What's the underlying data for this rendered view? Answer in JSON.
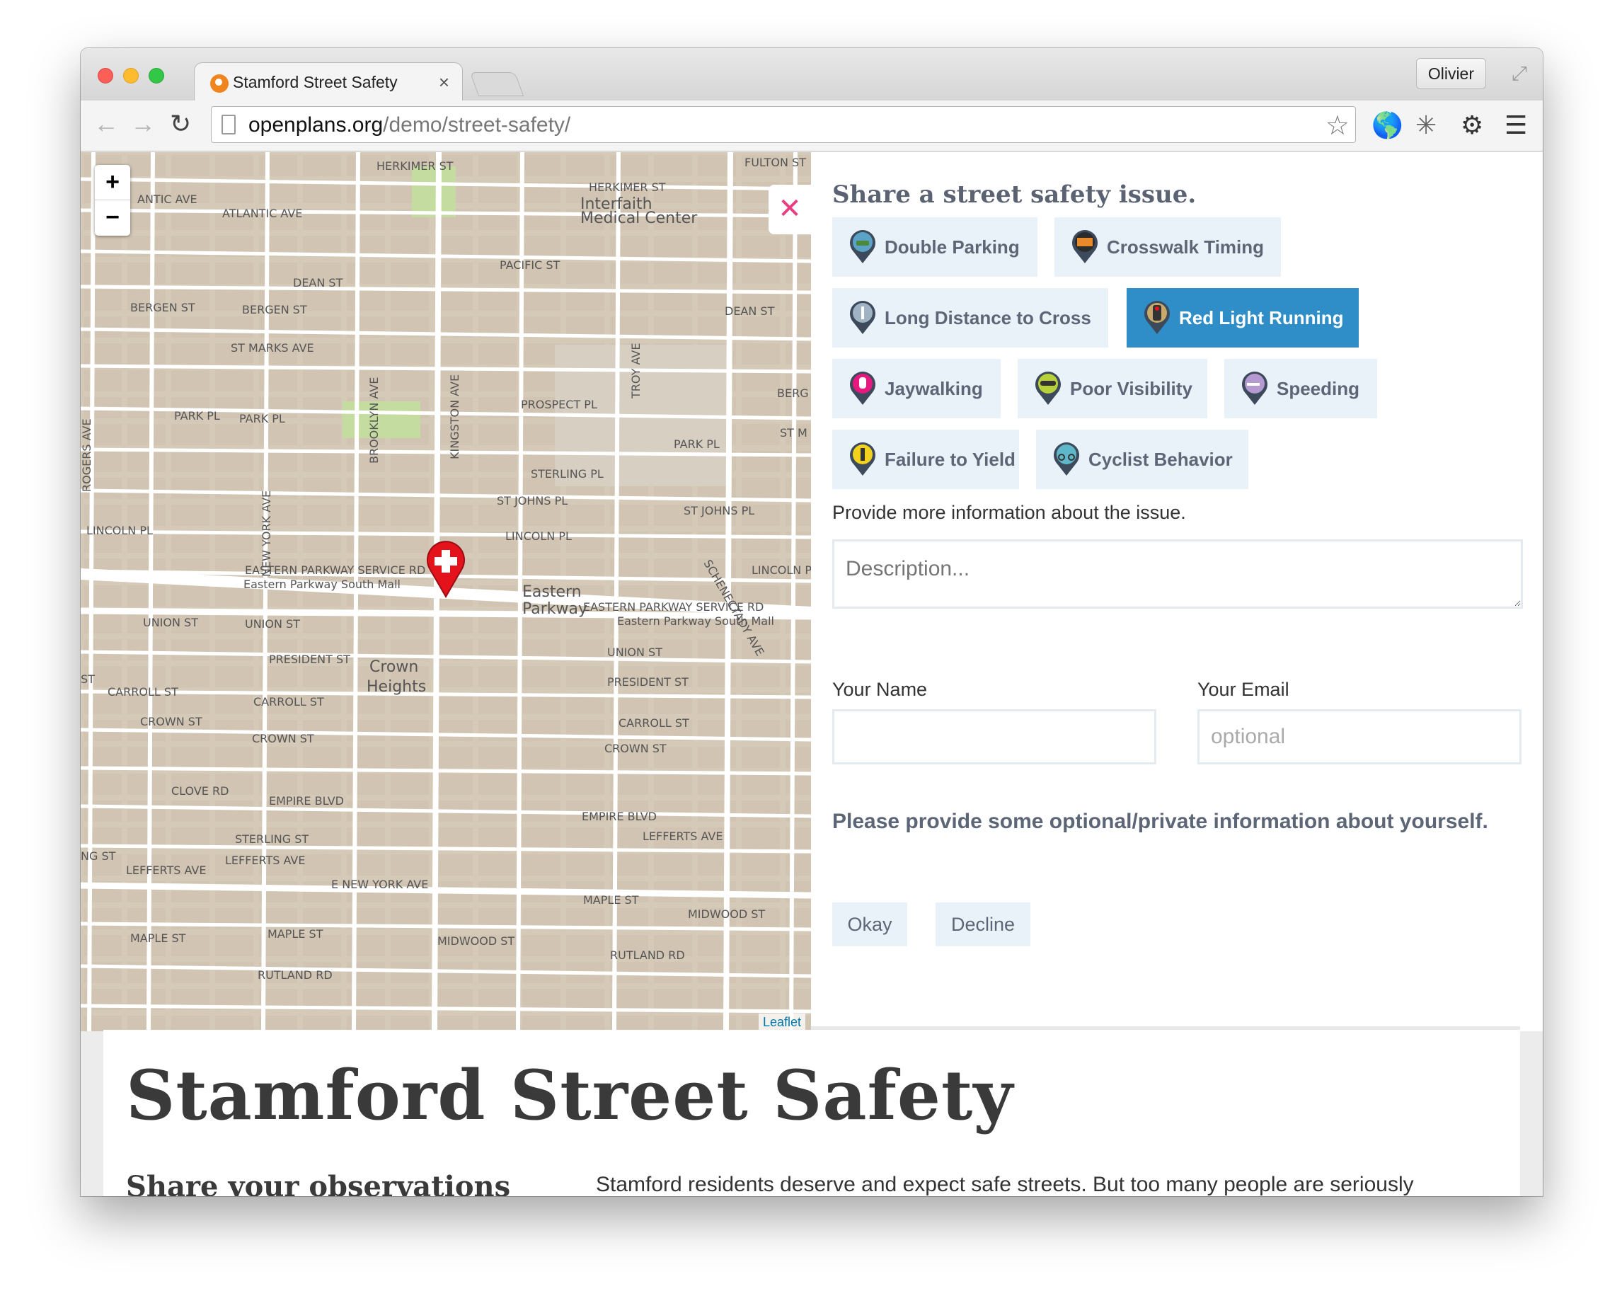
{
  "browser": {
    "tab_title": "Stamford Street Safety",
    "tab_close": "×",
    "profile_name": "Olivier",
    "url_host": "openplans.org",
    "url_path": "/demo/street-safety/",
    "back_icon": "←",
    "forward_icon": "→",
    "reload_icon": "↻",
    "star_icon": "☆",
    "fullscreen_icon": "⤢",
    "extensions": [
      {
        "name": "globe-icon",
        "glyph": "🌎"
      },
      {
        "name": "puzzle-extension-icon",
        "glyph": "✳"
      },
      {
        "name": "gear-icon",
        "glyph": "⚙"
      },
      {
        "name": "menu-icon",
        "glyph": "☰"
      }
    ]
  },
  "map": {
    "zoom_in": "+",
    "zoom_out": "−",
    "attribution": "Leaflet",
    "labels": [
      "HERKIMER ST",
      "FULTON ST",
      "HERKIMER ST",
      "Interfaith",
      "Medical Center",
      "ATLANTIC AVE",
      "ANTIC AVE",
      "PACIFIC ST",
      "DEAN ST",
      "BERGEN ST",
      "BERGEN ST",
      "DEAN ST",
      "ST MARKS AVE",
      "PROSPECT PL",
      "PARK PL",
      "PARK PL",
      "PARK PL",
      "STERLING PL",
      "ST JOHNS PL",
      "ST JOHNS PL",
      "LINCOLN PL",
      "LINCOLN PL",
      "LINCOLN PL",
      "EASTERN PARKWAY SERVICE RD",
      "Eastern Parkway South Mall",
      "Eastern",
      "Parkway",
      "EASTERN PARKWAY SERVICE RD",
      "Eastern Parkway South Mall",
      "UNION ST",
      "UNION ST",
      "UNION ST",
      "PRESIDENT ST",
      "Crown",
      "Heights",
      "PRESIDENT ST",
      "CARROLL ST",
      "CARROLL ST",
      "CARROLL ST",
      "CROWN ST",
      "CROWN ST",
      "CROWN ST",
      "EMPIRE BLVD",
      "EMPIRE BLVD",
      "STERLING ST",
      "LEFFERTS AVE",
      "LEFFERTS AVE",
      "LEFFERTS AVE",
      "E NEW YORK AVE",
      "MAPLE ST",
      "MAPLE ST",
      "MAPLE ST",
      "MIDWOOD ST",
      "MIDWOOD ST",
      "RUTLAND RD",
      "RUTLAND RD",
      "Mall",
      "ROGERS AVE",
      "NEW YORK AVE",
      "BROOKLYN AVE",
      "KINGSTON AVE",
      "TROY AVE",
      "SCHENECTADY AVE",
      "CLOVE RD",
      "NG ST",
      "ST",
      "ST M",
      "BERG"
    ]
  },
  "panel": {
    "close_icon": "✕",
    "title": "Share a street safety issue.",
    "categories": [
      {
        "label": "Double Parking",
        "icon": "double-parking-icon",
        "color": "#5aa3c7"
      },
      {
        "label": "Crosswalk Timing",
        "icon": "crosswalk-timing-icon",
        "color": "#e88a2c"
      },
      {
        "label": "Long Distance to Cross",
        "icon": "long-distance-icon",
        "color": "#9fb3c4"
      },
      {
        "label": "Red Light Running",
        "icon": "red-light-icon",
        "color": "#c7a96a"
      },
      {
        "label": "Jaywalking",
        "icon": "jaywalking-icon",
        "color": "#e5197e"
      },
      {
        "label": "Poor Visibility",
        "icon": "poor-visibility-icon",
        "color": "#b7d13a"
      },
      {
        "label": "Speeding",
        "icon": "speeding-icon",
        "color": "#b59ad1"
      },
      {
        "label": "Failure to Yield",
        "icon": "failure-to-yield-icon",
        "color": "#f2d21c"
      },
      {
        "label": "Cyclist Behavior",
        "icon": "cyclist-icon",
        "color": "#5fb8c9"
      }
    ],
    "selected_category": "Red Light Running",
    "description_label": "Provide more information about the issue.",
    "description_placeholder": "Description...",
    "name_label": "Your Name",
    "name_value": "",
    "email_label": "Your Email",
    "email_placeholder": "optional",
    "private_prompt": "Please provide some optional/private information about yourself.",
    "okay_label": "Okay",
    "decline_label": "Decline"
  },
  "page": {
    "site_title": "Stamford Street Safety",
    "sub_heading": "Share your observations",
    "intro": "Stamford residents deserve and expect safe streets. But too many people are seriously"
  },
  "colors": {
    "accent": "#2f8ec7",
    "button_bg": "#eaf2f9",
    "button_text": "#5d6676",
    "close_x": "#e93d82",
    "map_land": "#d5c9b8",
    "marker": "#e4121b"
  }
}
